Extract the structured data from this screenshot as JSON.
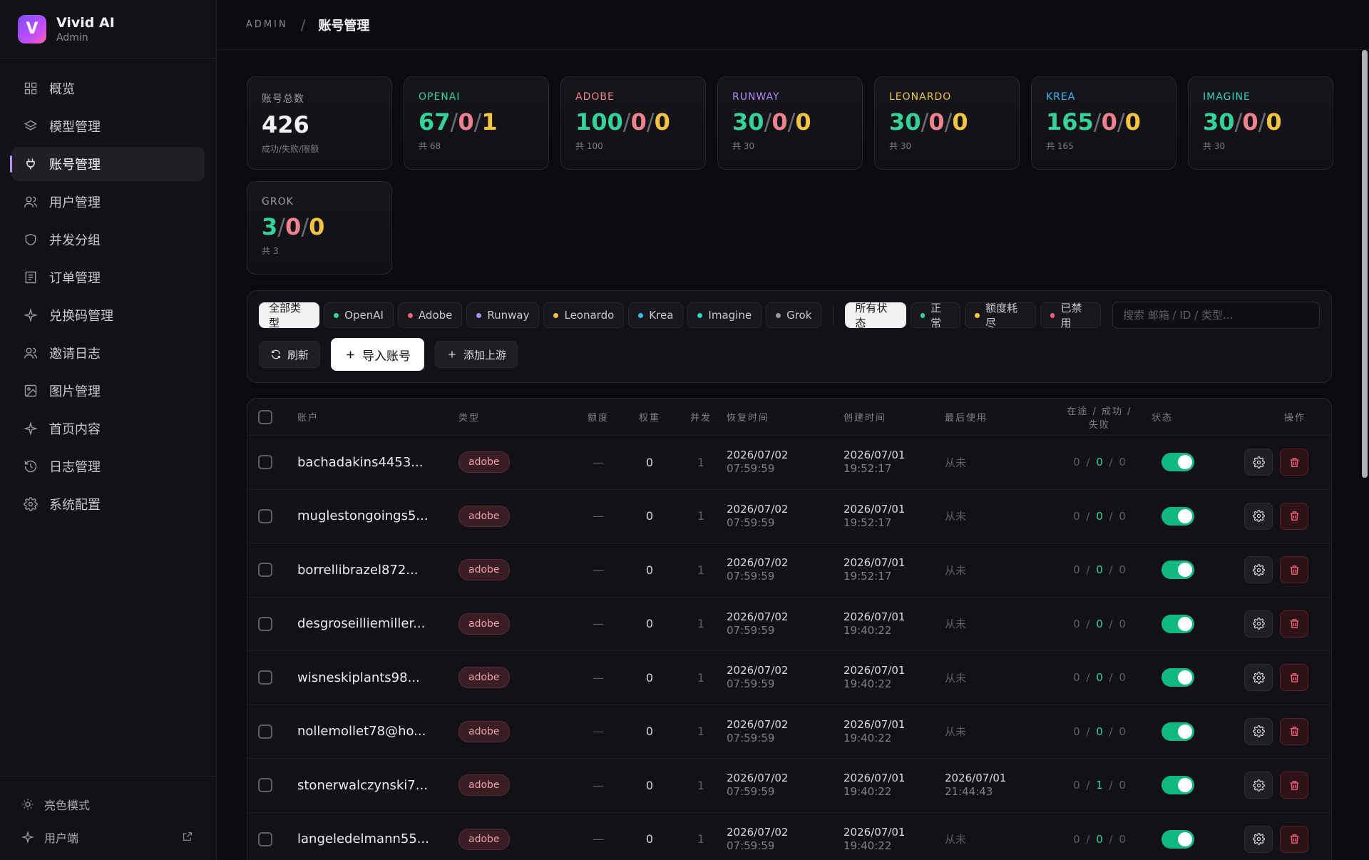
{
  "brand": {
    "name": "Vivid AI",
    "sub": "Admin",
    "logo_letter": "V"
  },
  "nav": [
    {
      "label": "概览",
      "icon": "grid-icon"
    },
    {
      "label": "模型管理",
      "icon": "layers-icon"
    },
    {
      "label": "账号管理",
      "icon": "plug-icon",
      "active": true
    },
    {
      "label": "用户管理",
      "icon": "users-icon"
    },
    {
      "label": "并发分组",
      "icon": "shield-icon"
    },
    {
      "label": "订单管理",
      "icon": "receipt-icon"
    },
    {
      "label": "兑换码管理",
      "icon": "sparkle-icon"
    },
    {
      "label": "邀请日志",
      "icon": "users-icon"
    },
    {
      "label": "图片管理",
      "icon": "image-icon"
    },
    {
      "label": "首页内容",
      "icon": "sparkle-icon"
    },
    {
      "label": "日志管理",
      "icon": "history-icon"
    },
    {
      "label": "系统配置",
      "icon": "gear-icon"
    }
  ],
  "sidebar_bottom": {
    "theme": "亮色模式",
    "client": "用户端"
  },
  "breadcrumb": {
    "root": "ADMIN",
    "sep": "/",
    "current": "账号管理"
  },
  "stats": [
    {
      "label": "账号总数",
      "value": "426",
      "sub": "成功/失败/限额"
    },
    {
      "label": "OPENAI",
      "ok": "67",
      "fail": "0",
      "lim": "1",
      "sub": "共 68"
    },
    {
      "label": "ADOBE",
      "ok": "100",
      "fail": "0",
      "lim": "0",
      "sub": "共 100"
    },
    {
      "label": "RUNWAY",
      "ok": "30",
      "fail": "0",
      "lim": "0",
      "sub": "共 30"
    },
    {
      "label": "LEONARDO",
      "ok": "30",
      "fail": "0",
      "lim": "0",
      "sub": "共 30"
    },
    {
      "label": "KREA",
      "ok": "165",
      "fail": "0",
      "lim": "0",
      "sub": "共 165"
    },
    {
      "label": "IMAGINE",
      "ok": "30",
      "fail": "0",
      "lim": "0",
      "sub": "共 30"
    },
    {
      "label": "GROK",
      "ok": "3",
      "fail": "0",
      "lim": "0",
      "sub": "共 3"
    }
  ],
  "type_filters": [
    {
      "label": "全部类型",
      "active": true
    },
    {
      "label": "OpenAI",
      "dot": "#34d399"
    },
    {
      "label": "Adobe",
      "dot": "#f0607a"
    },
    {
      "label": "Runway",
      "dot": "#b08cff"
    },
    {
      "label": "Leonardo",
      "dot": "#f5c542"
    },
    {
      "label": "Krea",
      "dot": "#38bdf8"
    },
    {
      "label": "Imagine",
      "dot": "#2dd4bf"
    },
    {
      "label": "Grok",
      "dot": "#9a9aa3"
    }
  ],
  "status_filters": [
    {
      "label": "所有状态",
      "active": true
    },
    {
      "label": "正常",
      "dot": "#34d399"
    },
    {
      "label": "额度耗尽",
      "dot": "#f5c542"
    },
    {
      "label": "已禁用",
      "dot": "#f0607a"
    }
  ],
  "search": {
    "placeholder": "搜索 邮箱 / ID / 类型..."
  },
  "actions": {
    "refresh": "刷新",
    "import": "导入账号",
    "add_upstream": "添加上游"
  },
  "table": {
    "headers": {
      "account": "账户",
      "type": "类型",
      "quota": "额度",
      "weight": "权重",
      "concurrency": "并发",
      "recover": "恢复时间",
      "created": "创建时间",
      "last_used": "最后使用",
      "counts": "在途 / 成功 / 失败",
      "status": "状态",
      "ops": "操作"
    },
    "rows": [
      {
        "account": "bachadakins4453...",
        "type": "adobe",
        "quota": "—",
        "weight": "0",
        "concurrency": "1",
        "recover_date": "2026/07/02",
        "recover_time": "07:59:59",
        "created_date": "2026/07/01",
        "created_time": "19:52:17",
        "last_used": "从未",
        "last_used_time": "",
        "inflight": "0",
        "success": "0",
        "fail": "0",
        "enabled": true
      },
      {
        "account": "muglestongoings5...",
        "type": "adobe",
        "quota": "—",
        "weight": "0",
        "concurrency": "1",
        "recover_date": "2026/07/02",
        "recover_time": "07:59:59",
        "created_date": "2026/07/01",
        "created_time": "19:52:17",
        "last_used": "从未",
        "last_used_time": "",
        "inflight": "0",
        "success": "0",
        "fail": "0",
        "enabled": true
      },
      {
        "account": "borrellibrazel872...",
        "type": "adobe",
        "quota": "—",
        "weight": "0",
        "concurrency": "1",
        "recover_date": "2026/07/02",
        "recover_time": "07:59:59",
        "created_date": "2026/07/01",
        "created_time": "19:52:17",
        "last_used": "从未",
        "last_used_time": "",
        "inflight": "0",
        "success": "0",
        "fail": "0",
        "enabled": true
      },
      {
        "account": "desgroseilliemiller...",
        "type": "adobe",
        "quota": "—",
        "weight": "0",
        "concurrency": "1",
        "recover_date": "2026/07/02",
        "recover_time": "07:59:59",
        "created_date": "2026/07/01",
        "created_time": "19:40:22",
        "last_used": "从未",
        "last_used_time": "",
        "inflight": "0",
        "success": "0",
        "fail": "0",
        "enabled": true
      },
      {
        "account": "wisneskiplants98...",
        "type": "adobe",
        "quota": "—",
        "weight": "0",
        "concurrency": "1",
        "recover_date": "2026/07/02",
        "recover_time": "07:59:59",
        "created_date": "2026/07/01",
        "created_time": "19:40:22",
        "last_used": "从未",
        "last_used_time": "",
        "inflight": "0",
        "success": "0",
        "fail": "0",
        "enabled": true
      },
      {
        "account": "nollemollet78@ho...",
        "type": "adobe",
        "quota": "—",
        "weight": "0",
        "concurrency": "1",
        "recover_date": "2026/07/02",
        "recover_time": "07:59:59",
        "created_date": "2026/07/01",
        "created_time": "19:40:22",
        "last_used": "从未",
        "last_used_time": "",
        "inflight": "0",
        "success": "0",
        "fail": "0",
        "enabled": true
      },
      {
        "account": "stonerwalczynski7...",
        "type": "adobe",
        "quota": "—",
        "weight": "0",
        "concurrency": "1",
        "recover_date": "2026/07/02",
        "recover_time": "07:59:59",
        "created_date": "2026/07/01",
        "created_time": "19:40:22",
        "last_used": "2026/07/01",
        "last_used_time": "21:44:43",
        "inflight": "0",
        "success": "1",
        "fail": "0",
        "enabled": true
      },
      {
        "account": "langeledelmann55...",
        "type": "adobe",
        "quota": "—",
        "weight": "0",
        "concurrency": "1",
        "recover_date": "2026/07/02",
        "recover_time": "07:59:59",
        "created_date": "2026/07/01",
        "created_time": "19:40:22",
        "last_used": "从未",
        "last_used_time": "",
        "inflight": "0",
        "success": "0",
        "fail": "0",
        "enabled": true
      }
    ]
  },
  "colors": {
    "accent": "#b98cff",
    "success": "#34d399",
    "danger": "#f0607a",
    "warning": "#f5c542"
  }
}
